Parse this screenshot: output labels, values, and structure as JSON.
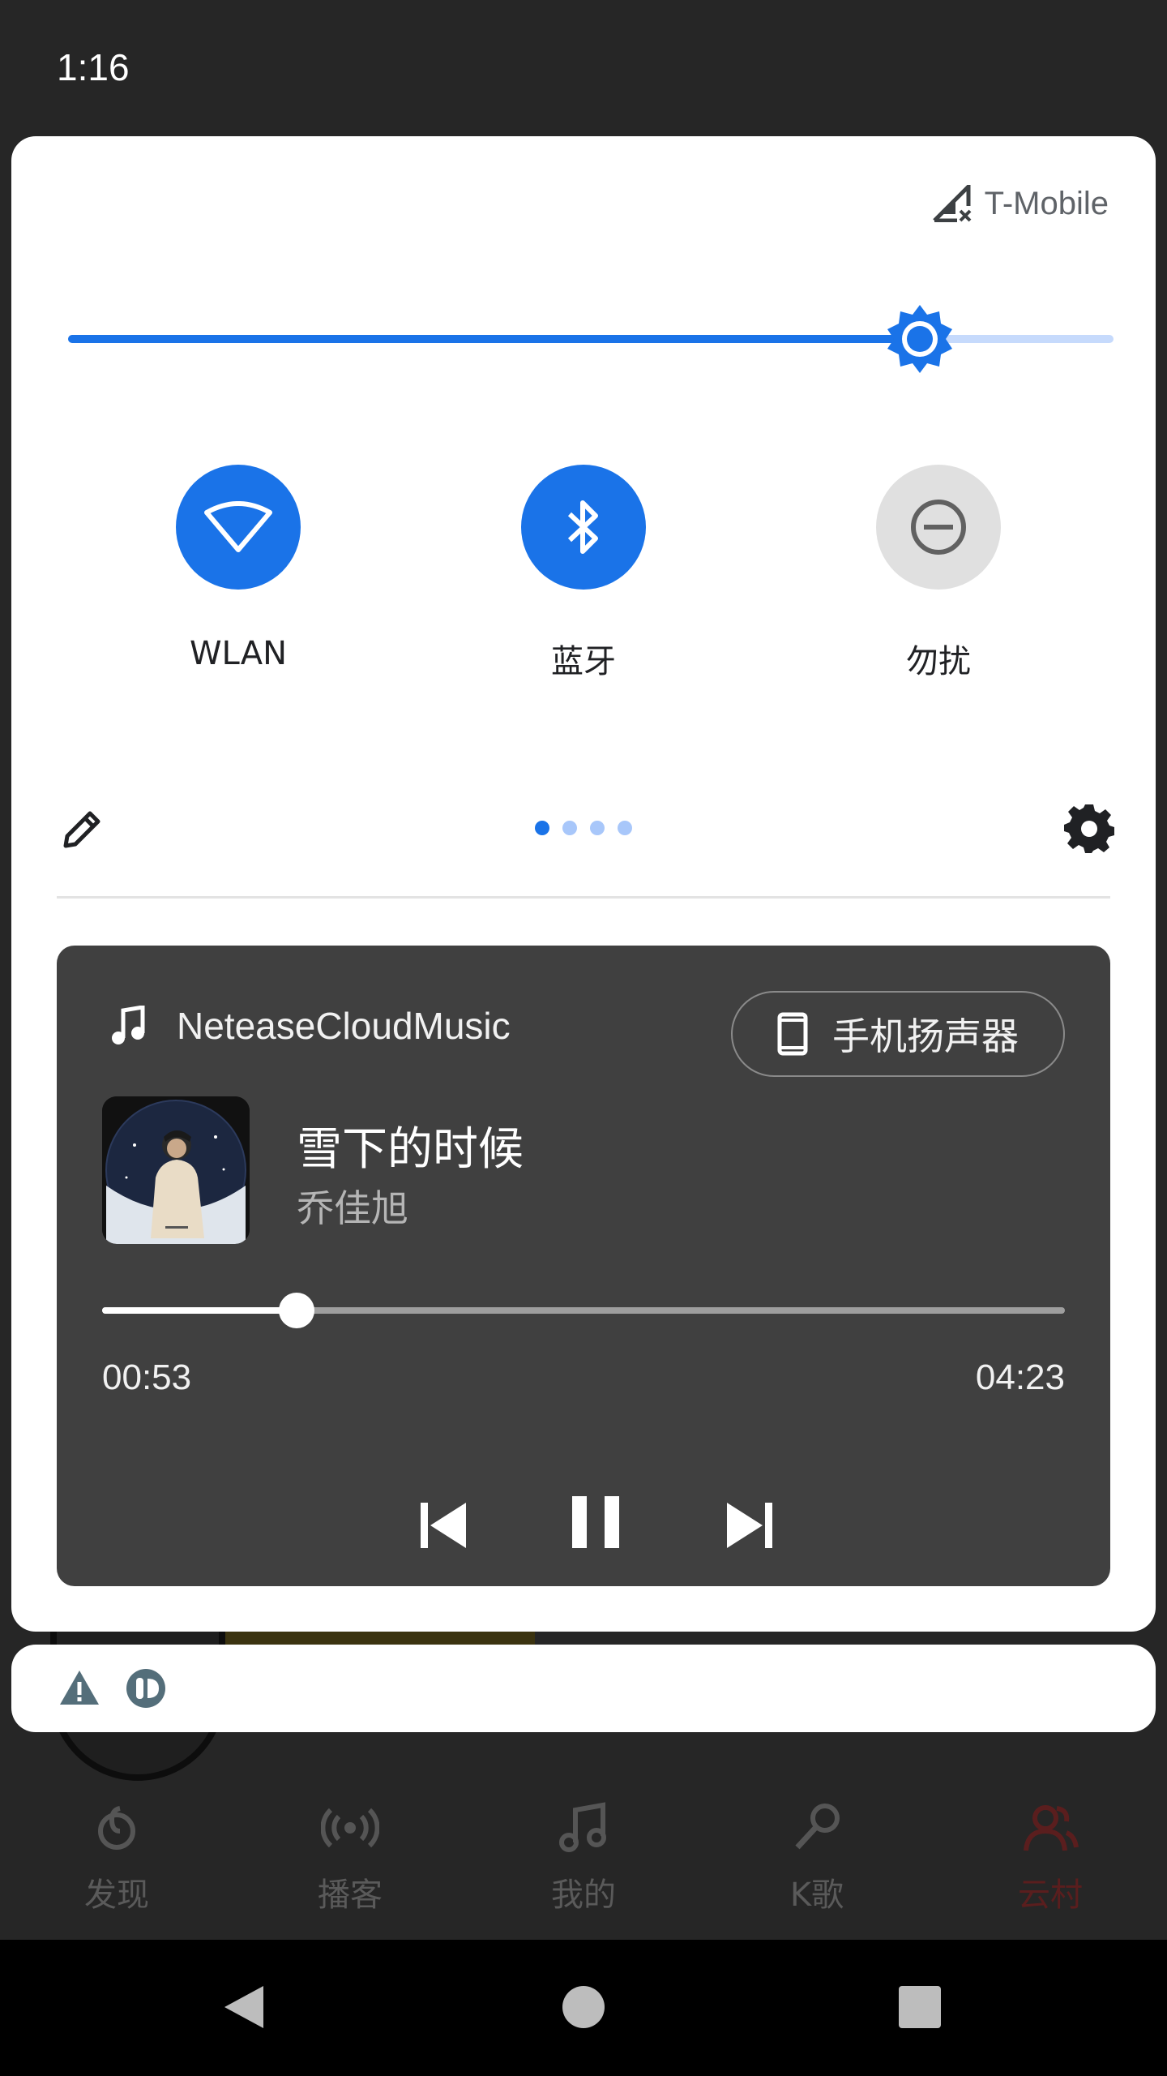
{
  "status_bar": {
    "time": "1:16"
  },
  "quick_settings": {
    "carrier": "T-Mobile",
    "brightness_level": 0.815,
    "tiles": [
      {
        "label": "WLAN",
        "icon": "wifi-icon",
        "state": "on"
      },
      {
        "label": "蓝牙",
        "icon": "bluetooth-icon",
        "state": "on"
      },
      {
        "label": "勿扰",
        "icon": "do-not-disturb-icon",
        "state": "off"
      }
    ],
    "page_count": 4,
    "active_page": 1,
    "accent_color": "#1a73e8"
  },
  "media": {
    "app_name": "NeteaseCloudMusic",
    "output_device": "手机扬声器",
    "title": "雪下的时候",
    "artist": "乔佳旭",
    "elapsed": "00:53",
    "duration": "04:23",
    "progress": 0.202,
    "controls": [
      "previous-icon",
      "pause-icon",
      "next-icon"
    ]
  },
  "background_app": {
    "tabs": [
      {
        "label": "发现",
        "icon": "discover-icon",
        "active": false
      },
      {
        "label": "播客",
        "icon": "podcast-icon",
        "active": false
      },
      {
        "label": "我的",
        "icon": "music-note-icon",
        "active": false
      },
      {
        "label": "K歌",
        "icon": "microphone-icon",
        "active": false
      },
      {
        "label": "云村",
        "icon": "users-icon",
        "active": true
      }
    ]
  }
}
